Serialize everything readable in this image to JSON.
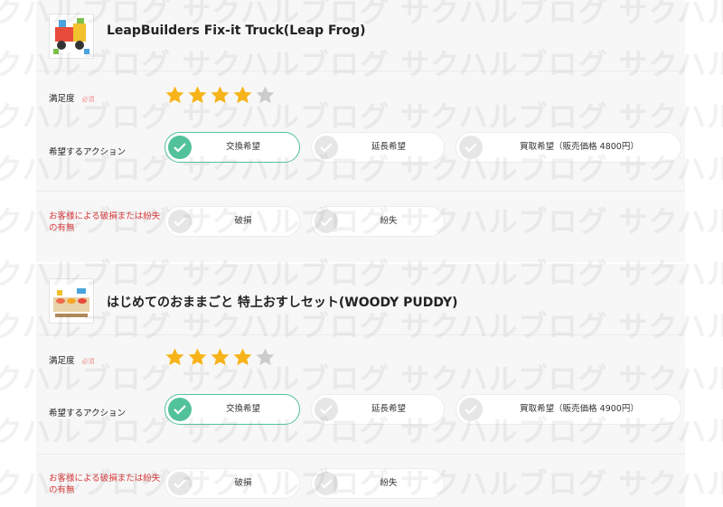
{
  "colors": {
    "accent": "#52c29a",
    "star_on": "#f6b41a",
    "star_off": "#cccccc",
    "required": "#d9383a"
  },
  "watermark": "サクハルブログ サクハルブログ サクハルブログ サクハルブログ サクハルブログ",
  "items": [
    {
      "title": "LeapBuilders Fix-it Truck(Leap Frog)",
      "satisfaction_label": "満足度",
      "required_tag": "必須",
      "rating": 4,
      "rating_max": 5,
      "action_label": "希望するアクション",
      "actions": [
        {
          "label": "交換希望",
          "selected": true
        },
        {
          "label": "延長希望",
          "selected": false
        },
        {
          "label": "買取希望（販売価格 4800円）",
          "selected": false
        }
      ],
      "damage_label": "お客様による破損または紛失の有無",
      "damage_options": [
        {
          "label": "破損",
          "selected": false
        },
        {
          "label": "紛失",
          "selected": false
        }
      ]
    },
    {
      "title": "はじめてのおままごと 特上おすしセット(WOODY PUDDY)",
      "satisfaction_label": "満足度",
      "required_tag": "必須",
      "rating": 4,
      "rating_max": 5,
      "action_label": "希望するアクション",
      "actions": [
        {
          "label": "交換希望",
          "selected": true
        },
        {
          "label": "延長希望",
          "selected": false
        },
        {
          "label": "買取希望（販売価格 4900円）",
          "selected": false
        }
      ],
      "damage_label": "お客様による破損または紛失の有無",
      "damage_options": [
        {
          "label": "破損",
          "selected": false
        },
        {
          "label": "紛失",
          "selected": false
        }
      ]
    }
  ]
}
